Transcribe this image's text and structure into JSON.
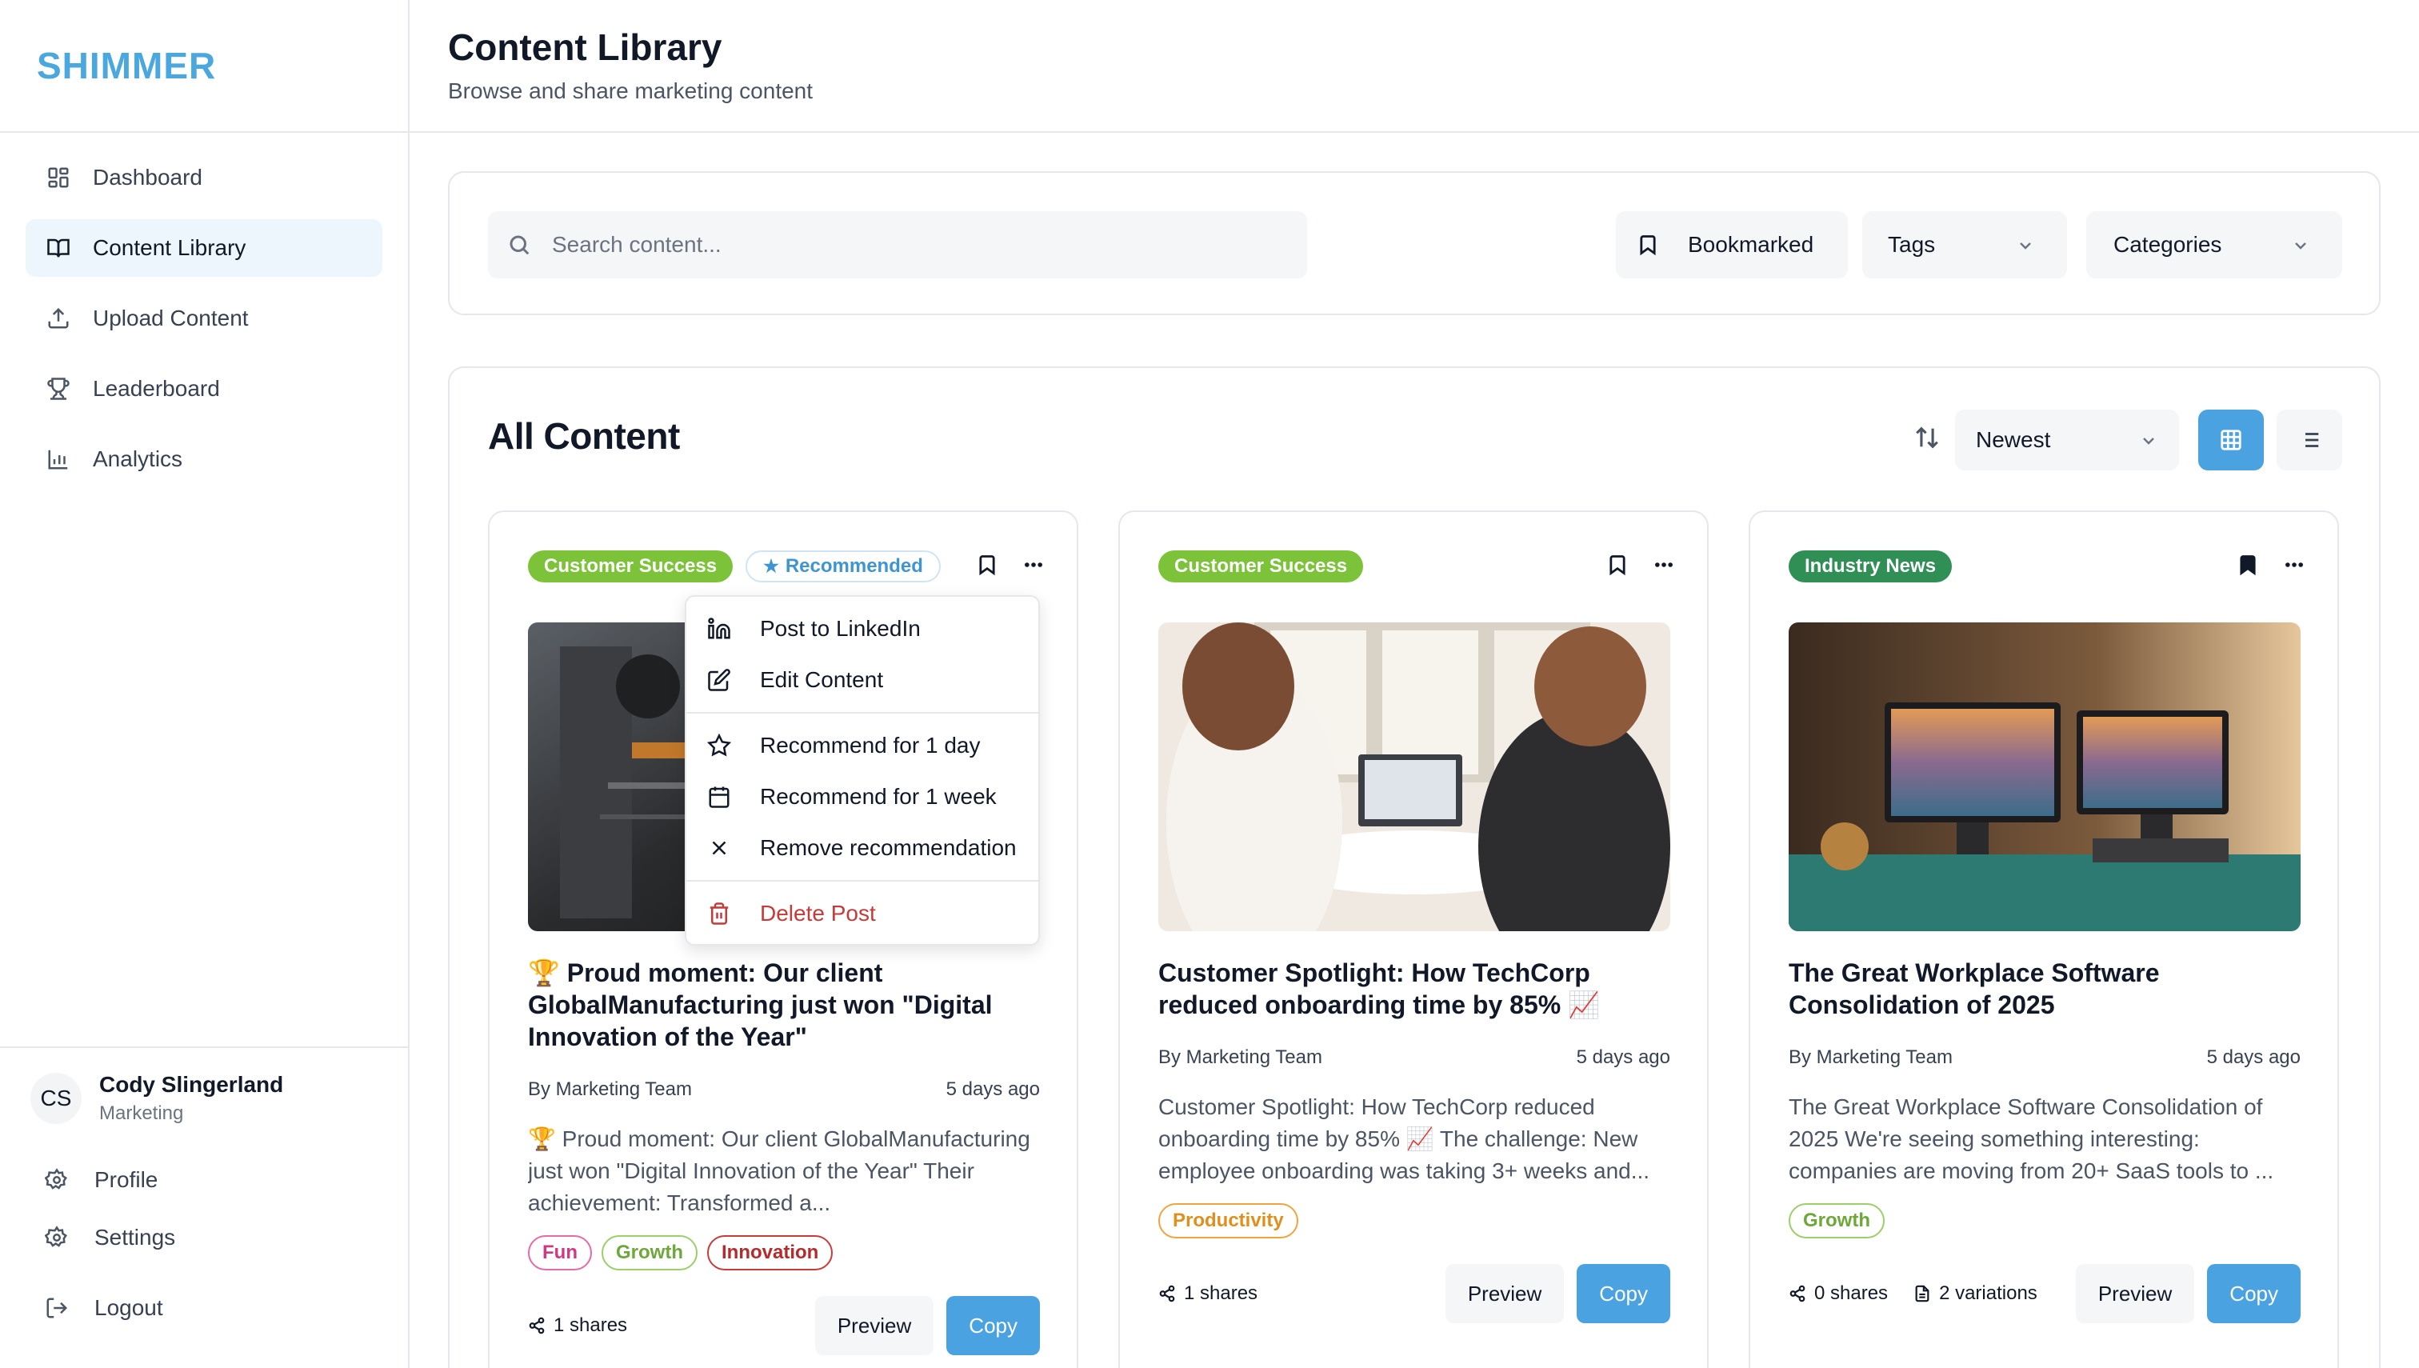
{
  "app": {
    "logo": "SHIMMER"
  },
  "sidebar": {
    "items": [
      {
        "label": "Dashboard",
        "icon": "dashboard-icon"
      },
      {
        "label": "Content Library",
        "icon": "book-icon",
        "active": true
      },
      {
        "label": "Upload Content",
        "icon": "upload-icon"
      },
      {
        "label": "Leaderboard",
        "icon": "trophy-icon"
      },
      {
        "label": "Analytics",
        "icon": "bar-chart-icon"
      }
    ],
    "user": {
      "initials": "CS",
      "name": "Cody Slingerland",
      "role": "Marketing"
    },
    "links": {
      "profile": "Profile",
      "settings": "Settings",
      "logout": "Logout"
    }
  },
  "header": {
    "title": "Content Library",
    "subtitle": "Browse and share marketing content"
  },
  "filters": {
    "search_placeholder": "Search content...",
    "bookmarked": "Bookmarked",
    "tags": "Tags",
    "categories": "Categories"
  },
  "content": {
    "title": "All Content",
    "sort": "Newest",
    "view": "grid",
    "accent_color": "#4aa3e0"
  },
  "cards": [
    {
      "category": "Customer Success",
      "recommended": "Recommended",
      "bookmarked": false,
      "title": "🏆 Proud moment: Our client GlobalManufacturing just won \"Digital Innovation of the Year\"",
      "author": "By Marketing Team",
      "time": "5 days ago",
      "excerpt": "🏆 Proud moment: Our client GlobalManufacturing just won \"Digital Innovation of the Year\" Their achievement: Transformed a...",
      "tags": [
        "Fun",
        "Growth",
        "Innovation"
      ],
      "shares": "1 shares",
      "preview": "Preview",
      "copy": "Copy"
    },
    {
      "category": "Customer Success",
      "bookmarked": false,
      "title": "Customer Spotlight: How TechCorp reduced onboarding time by 85% 📈",
      "author": "By Marketing Team",
      "time": "5 days ago",
      "excerpt": "Customer Spotlight: How TechCorp reduced onboarding time by 85% 📈 The challenge: New employee onboarding was taking 3+ weeks and...",
      "tags": [
        "Productivity"
      ],
      "shares": "1 shares",
      "preview": "Preview",
      "copy": "Copy"
    },
    {
      "category": "Industry News",
      "bookmarked": true,
      "title": "The Great Workplace Software Consolidation of 2025",
      "author": "By Marketing Team",
      "time": "5 days ago",
      "excerpt": "The Great Workplace Software Consolidation of 2025 We're seeing something interesting: companies are moving from 20+ SaaS tools to ...",
      "tags": [
        "Growth"
      ],
      "shares": "0 shares",
      "variations": "2 variations",
      "preview": "Preview",
      "copy": "Copy"
    }
  ],
  "menu": {
    "items": [
      {
        "label": "Post to LinkedIn",
        "icon": "linkedin-icon"
      },
      {
        "label": "Edit Content",
        "icon": "edit-icon"
      },
      {
        "label": "Recommend for 1 day",
        "icon": "star-icon"
      },
      {
        "label": "Recommend for 1 week",
        "icon": "calendar-icon"
      },
      {
        "label": "Remove recommendation",
        "icon": "x-icon"
      },
      {
        "label": "Delete Post",
        "icon": "trash-icon",
        "danger": true
      }
    ]
  }
}
